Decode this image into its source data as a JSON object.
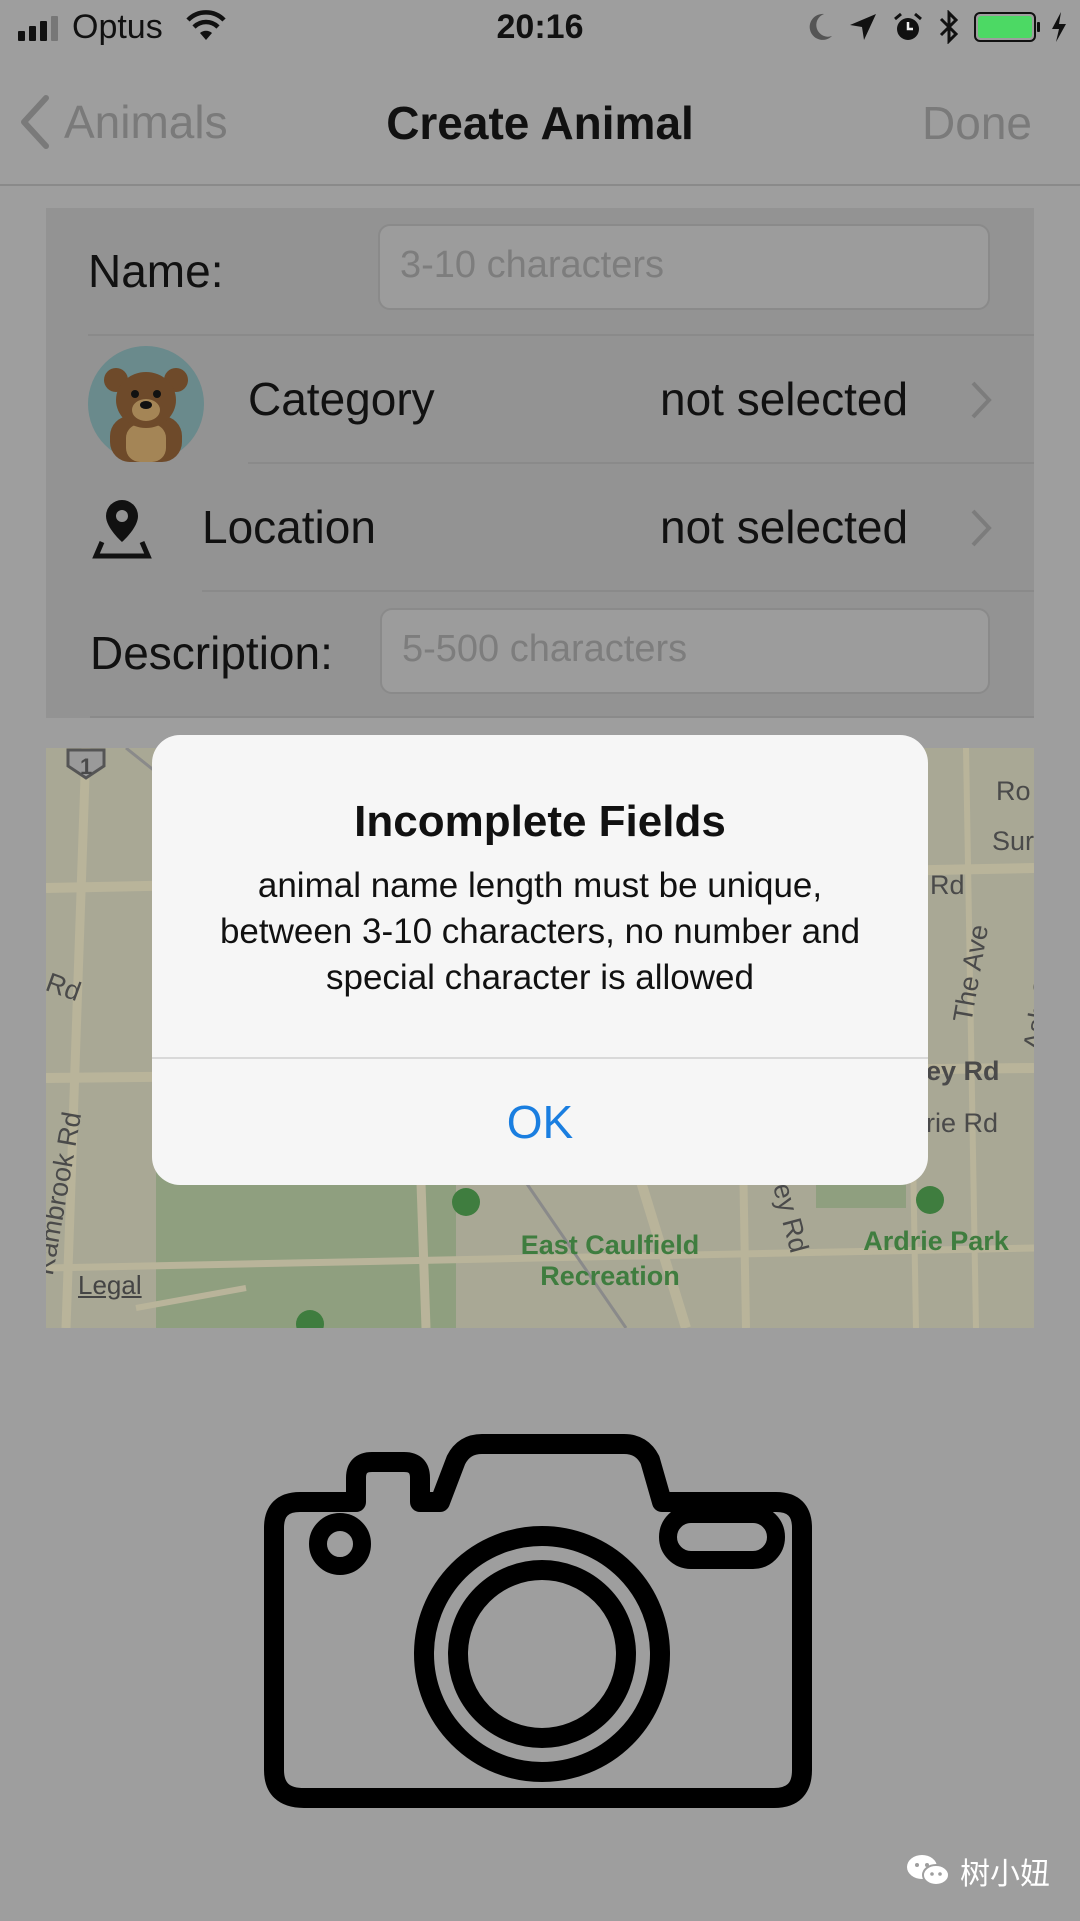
{
  "status_bar": {
    "carrier": "Optus",
    "time": "20:16",
    "battery_color": "#4cd964"
  },
  "nav": {
    "back_label": "Animals",
    "title": "Create Animal",
    "done_label": "Done"
  },
  "form": {
    "name_label": "Name:",
    "name_placeholder": "3-10 characters",
    "category_label": "Category",
    "category_value": "not selected",
    "location_label": "Location",
    "location_value": "not selected",
    "description_label": "Description:",
    "description_placeholder": "5-500 characters"
  },
  "map": {
    "legal": "Legal",
    "labels": {
      "rd_left": "Rd",
      "kambrook": "Kambrook Rd",
      "east_caulfield": "East Caulfield Recreation",
      "ardrie_park": "Ardrie Park",
      "ey_rd": "ey Rd",
      "rie_rd": "rie Rd",
      "the_ave": "The Ave",
      "ash_grove": "Ash Grove",
      "rd_top": "Rd",
      "sur": "Sur",
      "ro": "Ro",
      "arley_rd": "arley Rd",
      "shield": "1"
    }
  },
  "alert": {
    "title": "Incomplete Fields",
    "message": "animal name length must be unique, between 3-10 characters, no number and special character is allowed",
    "ok_label": "OK",
    "ok_color": "#1a7ee0"
  },
  "watermark": "树小妞",
  "icons": [
    "signal-icon",
    "wifi-icon",
    "moon-icon",
    "location-arrow-icon",
    "alarm-icon",
    "bluetooth-icon",
    "battery-icon",
    "charging-icon",
    "back-chevron-icon",
    "bear-avatar-icon",
    "location-pin-icon",
    "chevron-right-icon",
    "camera-icon",
    "wechat-icon"
  ]
}
